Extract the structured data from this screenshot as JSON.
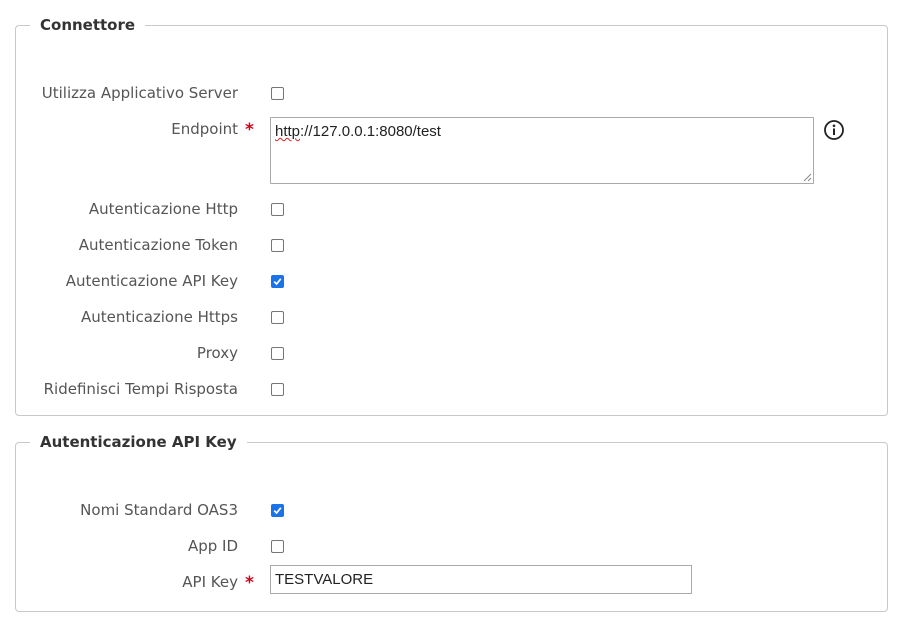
{
  "connettore": {
    "title": "Connettore",
    "utilizza_applicativo_server": {
      "label": "Utilizza Applicativo Server",
      "checked": false
    },
    "endpoint": {
      "label": "Endpoint",
      "required_mark": "*",
      "value": "http://127.0.0.1:8080/test",
      "value_prefix": "http",
      "value_rest": "://127.0.0.1:8080/test",
      "info_icon": "info-circle-icon"
    },
    "autenticazione_http": {
      "label": "Autenticazione Http",
      "checked": false
    },
    "autenticazione_token": {
      "label": "Autenticazione Token",
      "checked": false
    },
    "autenticazione_api_key": {
      "label": "Autenticazione API Key",
      "checked": true
    },
    "autenticazione_https": {
      "label": "Autenticazione Https",
      "checked": false
    },
    "proxy": {
      "label": "Proxy",
      "checked": false
    },
    "ridefinisci_tempi_risposta": {
      "label": "Ridefinisci Tempi Risposta",
      "checked": false
    }
  },
  "autenticazione_api_key_section": {
    "title": "Autenticazione API Key",
    "nomi_standard_oas3": {
      "label": "Nomi Standard OAS3",
      "checked": true
    },
    "app_id": {
      "label": "App ID",
      "checked": false
    },
    "api_key": {
      "label": "API Key",
      "required_mark": "*",
      "value": "TESTVALORE"
    }
  },
  "colors": {
    "checkbox_checked": "#1a73e8",
    "required": "#d0021b",
    "border": "#c9c9c9",
    "label": "#555555"
  }
}
